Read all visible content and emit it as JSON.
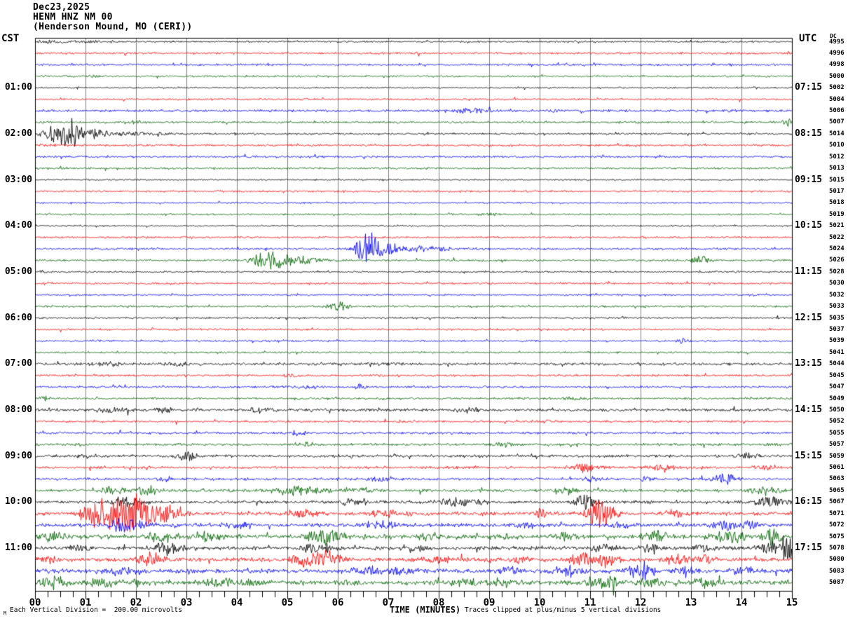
{
  "chart_data": {
    "type": "line",
    "subtype": "helicorder-seismogram",
    "title": "Dec23,2025",
    "station": "HENM HNZ NM 00",
    "location": "(Henderson Mound, MO (CERI))",
    "left_axis": {
      "header": "CST",
      "labels": [
        "01:00",
        "02:00",
        "03:00",
        "04:00",
        "05:00",
        "06:00",
        "07:00",
        "08:00",
        "09:00",
        "10:00",
        "11:00"
      ]
    },
    "right_axis": {
      "header": "UTC",
      "dc_header": "DC",
      "labels": [
        "07:15",
        "08:15",
        "09:15",
        "10:15",
        "11:15",
        "12:15",
        "13:15",
        "14:15",
        "15:15",
        "16:15",
        "17:15"
      ]
    },
    "x_axis": {
      "label": "TIME (MINUTES)",
      "tick_labels": [
        "00",
        "01",
        "02",
        "03",
        "04",
        "05",
        "06",
        "07",
        "08",
        "09",
        "10",
        "11",
        "12",
        "13",
        "14",
        "15"
      ],
      "minutes_per_line": 15,
      "minor_ticks_per_minute": 4
    },
    "footer": {
      "left_note": "Each Vertical Division =  200.00 microvolts",
      "right_note": "Traces clipped at plus/minus 5 vertical divisions",
      "corner_mark": "M"
    },
    "colors": {
      "trace_cycle": [
        "#000000",
        "#ff0000",
        "#0000ff",
        "#006400"
      ],
      "grid": "#808080",
      "border": "#000000",
      "background": "#ffffff",
      "text": "#000000"
    },
    "rows": [
      {
        "dc": 4995,
        "amp": 0.9,
        "bursts": [
          [
            0.35,
            0.35,
            2.5
          ],
          [
            1.1,
            0.4,
            2
          ]
        ]
      },
      {
        "dc": 4996,
        "amp": 1.0,
        "bursts": []
      },
      {
        "dc": 4998,
        "amp": 1.0,
        "bursts": []
      },
      {
        "dc": 5000,
        "amp": 0.9,
        "bursts": [
          [
            1.2,
            0.12,
            3
          ]
        ]
      },
      {
        "dc": 5002,
        "amp": 0.7,
        "bursts": []
      },
      {
        "dc": 5004,
        "amp": 0.9,
        "bursts": []
      },
      {
        "dc": 5006,
        "amp": 1.1,
        "bursts": [
          [
            8.6,
            0.6,
            3.5
          ],
          [
            10.3,
            0.25,
            2.5
          ],
          [
            13.9,
            0.2,
            2.5
          ]
        ]
      },
      {
        "dc": 5007,
        "amp": 1.0,
        "bursts": [
          [
            2.0,
            0.2,
            3
          ],
          [
            14.9,
            0.12,
            5
          ]
        ]
      },
      {
        "dc": 5014,
        "amp": 0.9,
        "bursts": [
          [
            0.4,
            0.3,
            12
          ],
          [
            0.75,
            0.25,
            20
          ],
          [
            1.15,
            0.4,
            8
          ],
          [
            2.0,
            0.8,
            3
          ]
        ]
      },
      {
        "dc": 5010,
        "amp": 1.0,
        "bursts": [
          [
            0.3,
            0.2,
            2.5
          ]
        ]
      },
      {
        "dc": 5012,
        "amp": 1.0,
        "bursts": []
      },
      {
        "dc": 5013,
        "amp": 0.9,
        "bursts": []
      },
      {
        "dc": 5015,
        "amp": 0.7,
        "bursts": []
      },
      {
        "dc": 5017,
        "amp": 0.9,
        "bursts": []
      },
      {
        "dc": 5018,
        "amp": 0.8,
        "bursts": []
      },
      {
        "dc": 5019,
        "amp": 0.8,
        "bursts": [
          [
            9.0,
            0.3,
            2
          ]
        ]
      },
      {
        "dc": 5021,
        "amp": 0.7,
        "bursts": []
      },
      {
        "dc": 5022,
        "amp": 0.9,
        "bursts": []
      },
      {
        "dc": 5024,
        "amp": 1.0,
        "bursts": [
          [
            6.55,
            0.25,
            22
          ],
          [
            6.9,
            0.5,
            8
          ],
          [
            7.8,
            0.6,
            4
          ]
        ]
      },
      {
        "dc": 5026,
        "amp": 1.0,
        "bursts": [
          [
            4.45,
            0.25,
            10
          ],
          [
            4.8,
            0.35,
            15
          ],
          [
            5.3,
            0.4,
            6
          ],
          [
            13.2,
            0.22,
            7
          ]
        ]
      },
      {
        "dc": 5028,
        "amp": 0.8,
        "bursts": [
          [
            0.15,
            0.08,
            3
          ]
        ]
      },
      {
        "dc": 5030,
        "amp": 0.9,
        "bursts": []
      },
      {
        "dc": 5032,
        "amp": 0.8,
        "bursts": []
      },
      {
        "dc": 5033,
        "amp": 0.9,
        "bursts": [
          [
            6.0,
            0.25,
            8
          ]
        ]
      },
      {
        "dc": 5035,
        "amp": 0.8,
        "bursts": []
      },
      {
        "dc": 5037,
        "amp": 0.9,
        "bursts": []
      },
      {
        "dc": 5039,
        "amp": 0.9,
        "bursts": [
          [
            12.85,
            0.15,
            4
          ]
        ]
      },
      {
        "dc": 5041,
        "amp": 0.9,
        "bursts": []
      },
      {
        "dc": 5044,
        "amp": 1.2,
        "bursts": [
          [
            1.4,
            0.5,
            3
          ],
          [
            2.8,
            0.4,
            2.5
          ],
          [
            7.1,
            0.3,
            2.5
          ]
        ]
      },
      {
        "dc": 5045,
        "amp": 1.0,
        "bursts": [
          [
            5.0,
            0.3,
            2.5
          ]
        ]
      },
      {
        "dc": 5047,
        "amp": 1.0,
        "bursts": [
          [
            5.3,
            0.4,
            2.5
          ],
          [
            6.45,
            0.15,
            4
          ]
        ]
      },
      {
        "dc": 5049,
        "amp": 1.0,
        "bursts": [
          [
            0.2,
            0.15,
            4
          ],
          [
            10.6,
            0.4,
            2.5
          ]
        ]
      },
      {
        "dc": 5050,
        "amp": 1.4,
        "bursts": [
          [
            1.5,
            0.4,
            4
          ],
          [
            2.55,
            0.2,
            5
          ],
          [
            4.45,
            0.3,
            5
          ],
          [
            8.6,
            0.3,
            3
          ]
        ]
      },
      {
        "dc": 5052,
        "amp": 1.0,
        "bursts": [
          [
            10.1,
            0.2,
            3
          ]
        ]
      },
      {
        "dc": 5055,
        "amp": 1.1,
        "bursts": [
          [
            5.2,
            0.2,
            4
          ]
        ]
      },
      {
        "dc": 5057,
        "amp": 1.2,
        "bursts": [
          [
            5.4,
            0.2,
            4
          ],
          [
            9.3,
            0.3,
            3
          ]
        ]
      },
      {
        "dc": 5059,
        "amp": 1.3,
        "bursts": [
          [
            0.9,
            0.3,
            3
          ],
          [
            3.0,
            0.25,
            7
          ],
          [
            14.1,
            0.3,
            4
          ]
        ]
      },
      {
        "dc": 5061,
        "amp": 1.2,
        "bursts": [
          [
            10.9,
            0.35,
            7
          ],
          [
            12.4,
            0.4,
            5
          ],
          [
            14.5,
            0.3,
            4
          ]
        ]
      },
      {
        "dc": 5063,
        "amp": 1.2,
        "bursts": [
          [
            2.6,
            0.2,
            4
          ],
          [
            6.8,
            0.25,
            4
          ],
          [
            11.0,
            0.3,
            4
          ],
          [
            12.1,
            0.2,
            4
          ],
          [
            13.65,
            0.3,
            8
          ]
        ]
      },
      {
        "dc": 5065,
        "amp": 1.4,
        "bursts": [
          [
            1.5,
            0.3,
            6
          ],
          [
            2.2,
            0.25,
            8
          ],
          [
            5.3,
            0.6,
            7
          ],
          [
            6.5,
            0.3,
            5
          ],
          [
            10.5,
            0.3,
            4
          ],
          [
            14.5,
            0.4,
            6
          ]
        ]
      },
      {
        "dc": 5067,
        "amp": 1.5,
        "bursts": [
          [
            1.8,
            0.4,
            6
          ],
          [
            6.3,
            0.4,
            5
          ],
          [
            8.4,
            0.5,
            6
          ],
          [
            10.9,
            0.25,
            11
          ],
          [
            14.6,
            0.35,
            9
          ]
        ]
      },
      {
        "dc": 5071,
        "amp": 1.7,
        "bursts": [
          [
            1.3,
            0.35,
            24
          ],
          [
            1.9,
            0.5,
            28
          ],
          [
            2.6,
            0.35,
            14
          ],
          [
            5.3,
            0.4,
            6
          ],
          [
            7.0,
            0.5,
            5
          ],
          [
            10.0,
            0.15,
            8
          ],
          [
            11.2,
            0.3,
            22
          ],
          [
            12.7,
            0.4,
            5
          ]
        ]
      },
      {
        "dc": 5072,
        "amp": 1.8,
        "bursts": [
          [
            1.8,
            0.45,
            11
          ],
          [
            4.0,
            0.3,
            4
          ],
          [
            6.9,
            0.5,
            5
          ],
          [
            9.8,
            0.4,
            5
          ],
          [
            11.6,
            0.3,
            5
          ],
          [
            13.7,
            0.3,
            8
          ],
          [
            14.2,
            0.25,
            5
          ]
        ]
      },
      {
        "dc": 5075,
        "amp": 2.1,
        "bursts": [
          [
            0.3,
            0.3,
            6
          ],
          [
            2.5,
            0.35,
            9
          ],
          [
            3.4,
            0.3,
            7
          ],
          [
            5.75,
            0.4,
            11
          ],
          [
            7.8,
            0.3,
            5
          ],
          [
            9.3,
            0.25,
            4
          ],
          [
            10.5,
            0.3,
            6
          ],
          [
            12.3,
            0.3,
            10
          ],
          [
            13.8,
            0.4,
            9
          ],
          [
            14.6,
            0.2,
            14
          ]
        ]
      },
      {
        "dc": 5078,
        "amp": 1.8,
        "bursts": [
          [
            0.9,
            0.3,
            4
          ],
          [
            2.65,
            0.3,
            11
          ],
          [
            5.6,
            0.4,
            7
          ],
          [
            7.5,
            0.3,
            5
          ],
          [
            11.3,
            0.3,
            6
          ],
          [
            12.2,
            0.2,
            9
          ],
          [
            13.2,
            0.3,
            5
          ],
          [
            14.6,
            0.3,
            10
          ],
          [
            14.9,
            0.15,
            18
          ]
        ]
      },
      {
        "dc": 5080,
        "amp": 1.9,
        "bursts": [
          [
            0.3,
            0.2,
            5
          ],
          [
            2.3,
            0.35,
            10
          ],
          [
            5.45,
            0.4,
            12
          ],
          [
            5.9,
            0.3,
            8
          ],
          [
            8.0,
            0.4,
            5
          ],
          [
            9.6,
            0.3,
            5
          ],
          [
            10.9,
            0.4,
            10
          ],
          [
            11.3,
            0.3,
            8
          ],
          [
            12.7,
            0.3,
            9
          ],
          [
            13.3,
            0.3,
            6
          ]
        ]
      },
      {
        "dc": 5083,
        "amp": 2.1,
        "bursts": [
          [
            1.7,
            0.4,
            6
          ],
          [
            6.6,
            0.4,
            6
          ],
          [
            7.3,
            0.3,
            5
          ],
          [
            9.4,
            0.3,
            6
          ],
          [
            10.6,
            0.3,
            8
          ],
          [
            12.0,
            0.3,
            13
          ],
          [
            12.9,
            0.3,
            6
          ],
          [
            14.0,
            0.3,
            7
          ]
        ]
      },
      {
        "dc": 5087,
        "amp": 2.3,
        "bursts": [
          [
            0.35,
            0.3,
            8
          ],
          [
            1.3,
            0.4,
            6
          ],
          [
            2.0,
            0.2,
            5
          ],
          [
            3.6,
            0.4,
            6
          ],
          [
            4.3,
            0.3,
            5
          ],
          [
            6.2,
            0.3,
            4
          ],
          [
            8.6,
            0.4,
            6
          ],
          [
            9.2,
            0.3,
            5
          ],
          [
            11.2,
            0.35,
            9
          ],
          [
            11.45,
            0.1,
            14
          ],
          [
            12.2,
            0.3,
            6
          ],
          [
            13.3,
            0.3,
            8
          ]
        ]
      }
    ]
  }
}
